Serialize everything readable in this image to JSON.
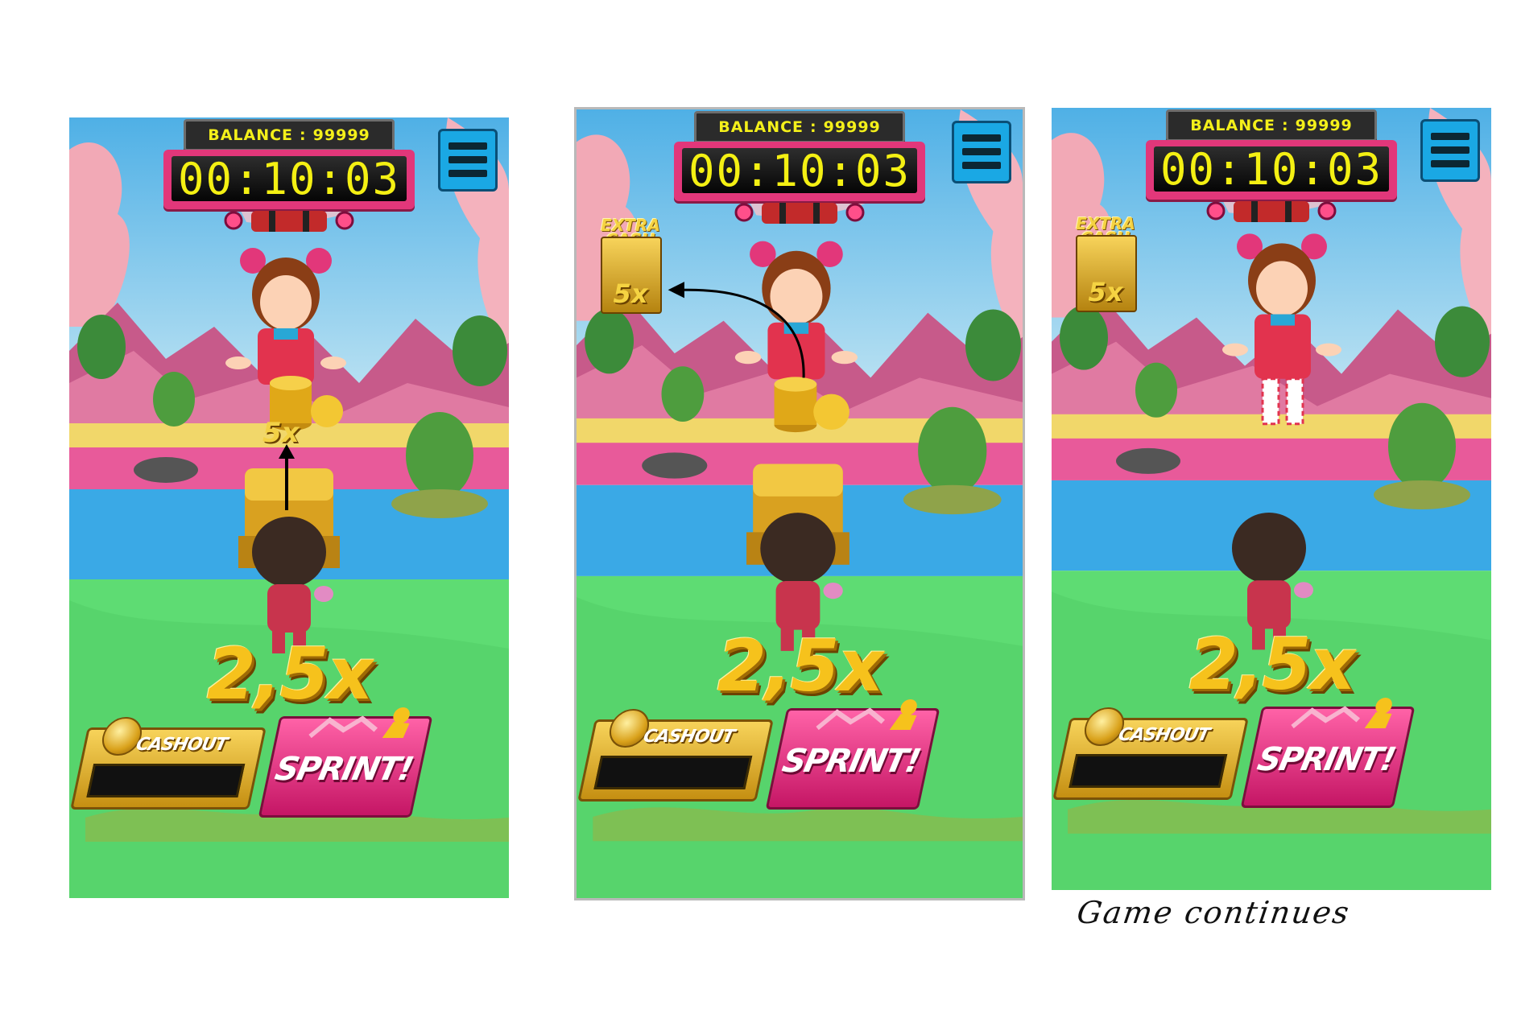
{
  "panels": [
    {
      "id": "before",
      "balance_label": "BALANCE",
      "balance_sep": ":",
      "balance_value": "99999",
      "timer": "00:10:03",
      "multiplier": "2,5x",
      "cashout_label": "CASHOUT",
      "sprint_label": "SPRINT!",
      "chest_multiplier": "5x",
      "icons": [
        "hamburger-menu-icon",
        "bomb-icon",
        "coin-icon",
        "runner-icon",
        "arrow-up-icon"
      ]
    },
    {
      "id": "transition",
      "balance_label": "BALANCE",
      "balance_sep": ":",
      "balance_value": "99999",
      "timer": "00:10:03",
      "multiplier": "2,5x",
      "cashout_label": "CASHOUT",
      "sprint_label": "SPRINT!",
      "extra_cash_line1": "EXTRA",
      "extra_cash_line2": "CASH",
      "extra_cash_multiplier": "5x",
      "icons": [
        "hamburger-menu-icon",
        "bomb-icon",
        "coin-icon",
        "runner-icon",
        "curved-arrow-icon"
      ]
    },
    {
      "id": "after",
      "balance_label": "BALANCE",
      "balance_sep": ":",
      "balance_value": "99999",
      "timer": "00:10:03",
      "multiplier": "2,5x",
      "cashout_label": "CASHOUT",
      "sprint_label": "SPRINT!",
      "extra_cash_line1": "EXTRA",
      "extra_cash_line2": "CASH",
      "extra_cash_multiplier": "5x",
      "icons": [
        "hamburger-menu-icon",
        "bomb-icon",
        "coin-icon",
        "runner-icon"
      ]
    }
  ],
  "caption": "Game continues",
  "colors": {
    "sky": "#86cde8",
    "grass": "#5edc73",
    "river": "#3aa9e6",
    "pink_track": "#e85a9a",
    "gold": "#f6c21c",
    "sprint_pink": "#e2377a",
    "menu_blue": "#1aa8e4"
  }
}
